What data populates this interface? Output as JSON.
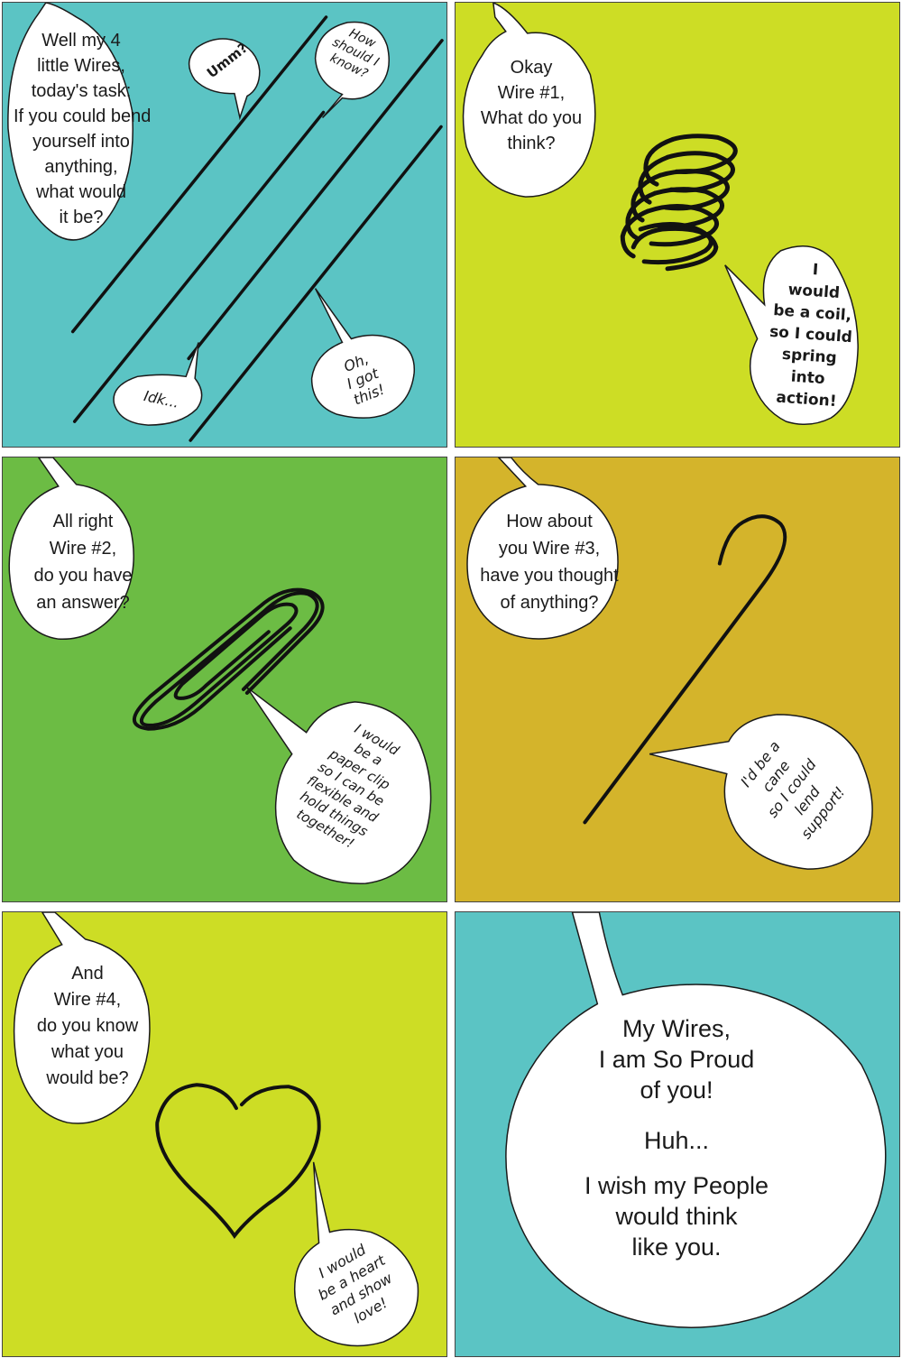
{
  "colors": {
    "panel1": "#5bc4c4",
    "panel2": "#cddd25",
    "panel3": "#6cbc44",
    "panel4": "#d4b42b",
    "panel5": "#cddd25",
    "panel6": "#5bc4c4",
    "bubble": "#ffffff",
    "outline": "#1a1a1a",
    "border": "#444444"
  },
  "panel1": {
    "narrator": [
      "Well my 4",
      "little Wires,",
      "today's task:",
      "If you could bend",
      "yourself into",
      "anything,",
      "what would",
      "it be?"
    ],
    "umm": "Umm?",
    "how": [
      "How",
      "should I",
      "know?"
    ],
    "idk": "Idk...",
    "oh": [
      "Oh,",
      "I got",
      "this!"
    ]
  },
  "panel2": {
    "narrator": [
      "Okay",
      "Wire #1,",
      "What do you",
      "think?"
    ],
    "reply": [
      "I",
      "would",
      "be a coil,",
      "so I could",
      "spring",
      "into",
      "action!"
    ]
  },
  "panel3": {
    "narrator": [
      "All right",
      "Wire #2,",
      "do you have",
      "an answer?"
    ],
    "reply": [
      "I would",
      "be a",
      "paper clip",
      "so I can be",
      "flexible and",
      "hold things",
      "together!"
    ]
  },
  "panel4": {
    "narrator": [
      "How about",
      "you Wire #3,",
      "have you thought",
      "of anything?"
    ],
    "reply": [
      "I'd be a",
      "cane",
      "so I could",
      "lend",
      "support!"
    ]
  },
  "panel5": {
    "narrator": [
      "And",
      "Wire #4,",
      "do you know",
      "what you",
      "would be?"
    ],
    "reply": [
      "I would",
      "be a heart",
      "and show",
      "love!"
    ]
  },
  "panel6": {
    "line1": [
      "My Wires,",
      "I am So Proud",
      "of you!"
    ],
    "line2": "Huh...",
    "line3": [
      "I wish my People",
      "would think",
      "like you."
    ]
  }
}
